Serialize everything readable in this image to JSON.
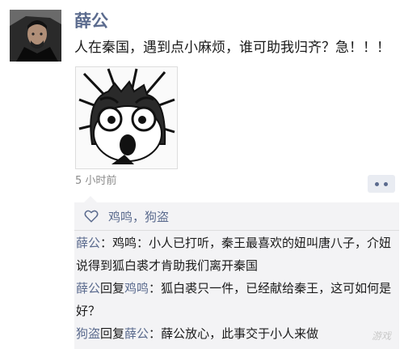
{
  "post": {
    "author": "薛公",
    "text": "人在秦国，遇到点小麻烦，谁可助我归齐？急！！！",
    "time": "5 小时前"
  },
  "likes": {
    "text": "鸡鸣，狗盗"
  },
  "comments": [
    {
      "name": "薛公",
      "sep": "：",
      "text": "鸡鸣：小人已打听，秦王最喜欢的妞叫唐八子，介妞说得到狐白裘才肯助我们离开秦国"
    },
    {
      "name": "薛公",
      "reply": "回复",
      "target": "鸡鸣",
      "sep": "：",
      "text": "狐白裘只一件，已经献给秦王，这可如何是好？"
    },
    {
      "name": "狗盗",
      "reply": "回复",
      "target": "薛公",
      "sep": "：",
      "text": "薛公放心，此事交于小人来做"
    }
  ],
  "watermark": "游戏",
  "icons": {
    "like": "heart-icon",
    "more": "more-icon"
  },
  "colors": {
    "name_link": "#5b6b8e",
    "comment_bg": "#f3f3f5"
  }
}
